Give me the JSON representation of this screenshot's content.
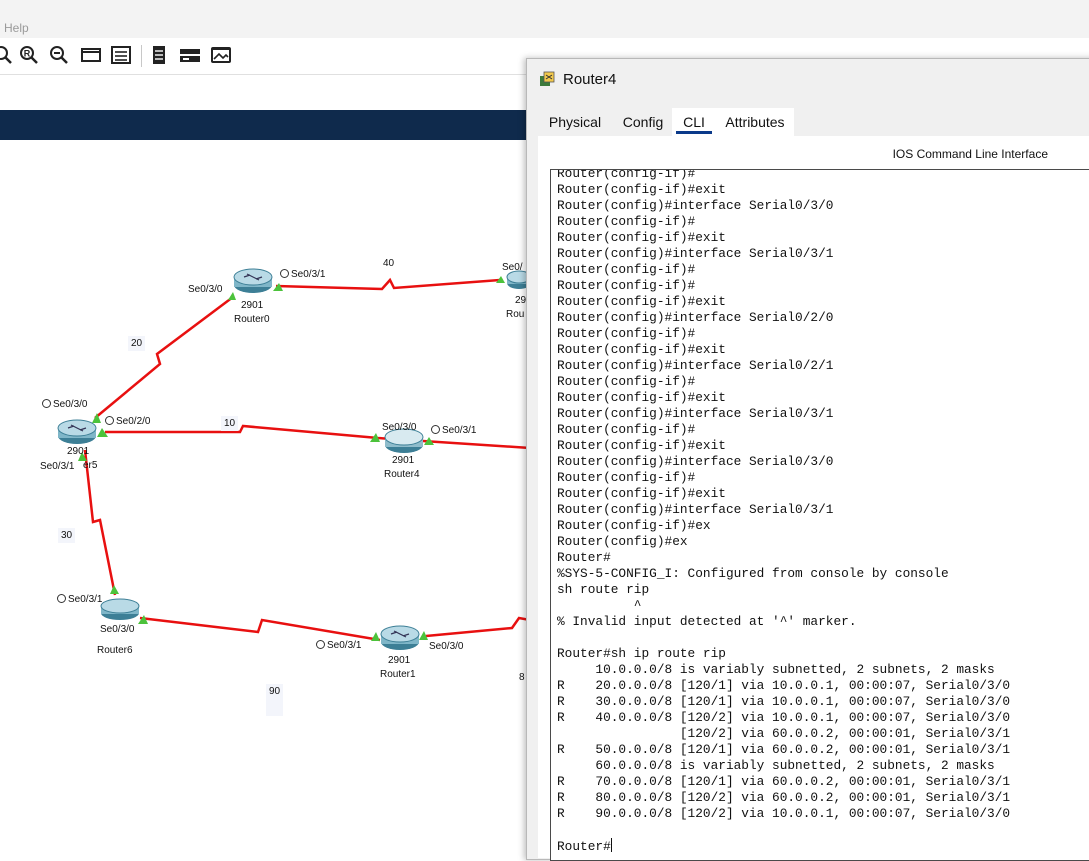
{
  "menubar": {
    "help_label": "Help"
  },
  "toolbar": {
    "icons": [
      "zoom-icon",
      "zoom-in-icon",
      "zoom-out-icon",
      "window-icon",
      "list-icon",
      "document-icon",
      "device-icon",
      "image-icon"
    ]
  },
  "topology": {
    "link_labels": [
      "40",
      "20",
      "10",
      "30",
      "90",
      "8"
    ],
    "routers": [
      {
        "model": "2901",
        "name": "Router0"
      },
      {
        "model": "2901",
        "name": "Router4"
      },
      {
        "model": "2901",
        "name": "Router1"
      },
      {
        "model": "2901",
        "name": "er5"
      },
      {
        "name": "Router6"
      },
      {
        "model": "29",
        "name": "Rou"
      }
    ],
    "ports": {
      "r0_se030": "Se0/3/0",
      "r0_se031": "Se0/3/1",
      "rr_se0": "Se0/",
      "r5_se030": "Se0/3/0",
      "r5_se020": "Se0/2/0",
      "r5_se031": "Se0/3/1",
      "r4_se030": "Se0/3/0",
      "r4_se031": "Se0/3/1",
      "r6_se031": "Se0/3/1",
      "r6_se030": "Se0/3/0",
      "r1_se031": "Se0/3/1",
      "r1_se030": "Se0/3/0"
    },
    "colors": {
      "link": "#e81010",
      "up": "#4cc23b"
    }
  },
  "window": {
    "title": "Router4",
    "tabs": [
      "Physical",
      "Config",
      "CLI",
      "Attributes"
    ],
    "active_tab": "CLI",
    "panel_heading": "IOS Command Line Interface",
    "console_lines": [
      "Router(config-if)#",
      "Router(config-if)#exit",
      "Router(config)#interface Serial0/3/0",
      "Router(config-if)#",
      "Router(config-if)#exit",
      "Router(config)#interface Serial0/3/1",
      "Router(config-if)#",
      "Router(config-if)#",
      "Router(config-if)#exit",
      "Router(config)#interface Serial0/2/0",
      "Router(config-if)#",
      "Router(config-if)#exit",
      "Router(config)#interface Serial0/2/1",
      "Router(config-if)#",
      "Router(config-if)#exit",
      "Router(config)#interface Serial0/3/1",
      "Router(config-if)#",
      "Router(config-if)#exit",
      "Router(config)#interface Serial0/3/0",
      "Router(config-if)#",
      "Router(config-if)#exit",
      "Router(config)#interface Serial0/3/1",
      "Router(config-if)#ex",
      "Router(config)#ex",
      "Router#",
      "%SYS-5-CONFIG_I: Configured from console by console",
      "sh route rip",
      "          ^",
      "% Invalid input detected at '^' marker.",
      "",
      "Router#sh ip route rip",
      "     10.0.0.0/8 is variably subnetted, 2 subnets, 2 masks",
      "R    20.0.0.0/8 [120/1] via 10.0.0.1, 00:00:07, Serial0/3/0",
      "R    30.0.0.0/8 [120/1] via 10.0.0.1, 00:00:07, Serial0/3/0",
      "R    40.0.0.0/8 [120/2] via 10.0.0.1, 00:00:07, Serial0/3/0",
      "                [120/2] via 60.0.0.2, 00:00:01, Serial0/3/1",
      "R    50.0.0.0/8 [120/1] via 60.0.0.2, 00:00:01, Serial0/3/1",
      "     60.0.0.0/8 is variably subnetted, 2 subnets, 2 masks",
      "R    70.0.0.0/8 [120/1] via 60.0.0.2, 00:00:01, Serial0/3/1",
      "R    80.0.0.0/8 [120/2] via 60.0.0.2, 00:00:01, Serial0/3/1",
      "R    90.0.0.0/8 [120/2] via 10.0.0.1, 00:00:07, Serial0/3/0",
      ""
    ],
    "prompt": "Router#"
  }
}
